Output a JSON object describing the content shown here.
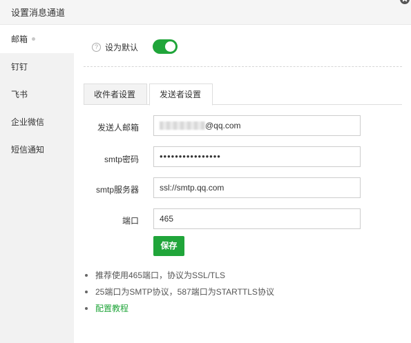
{
  "window": {
    "title": "设置消息通道"
  },
  "sidebar": {
    "items": [
      {
        "label": "邮箱"
      },
      {
        "label": "钉钉"
      },
      {
        "label": "飞书"
      },
      {
        "label": "企业微信"
      },
      {
        "label": "短信通知"
      }
    ]
  },
  "default_setting": {
    "help_glyph": "?",
    "label": "设为默认",
    "enabled": true
  },
  "tabs": [
    {
      "label": "收件者设置"
    },
    {
      "label": "发送者设置"
    }
  ],
  "form": {
    "sender_email": {
      "label": "发送人邮箱",
      "value_suffix": "@qq.com"
    },
    "smtp_password": {
      "label": "smtp密码",
      "value": "••••••••••••••••"
    },
    "smtp_server": {
      "label": "smtp服务器",
      "value": "ssl://smtp.qq.com"
    },
    "port": {
      "label": "端口",
      "value": "465"
    },
    "save_label": "保存"
  },
  "notes": [
    "推荐使用465端口，协议为SSL/TLS",
    "25端口为SMTP协议，587端口为STARTTLS协议",
    "配置教程"
  ],
  "colors": {
    "accent": "#20a53a",
    "sidebar_bg": "#f2f2f2"
  }
}
